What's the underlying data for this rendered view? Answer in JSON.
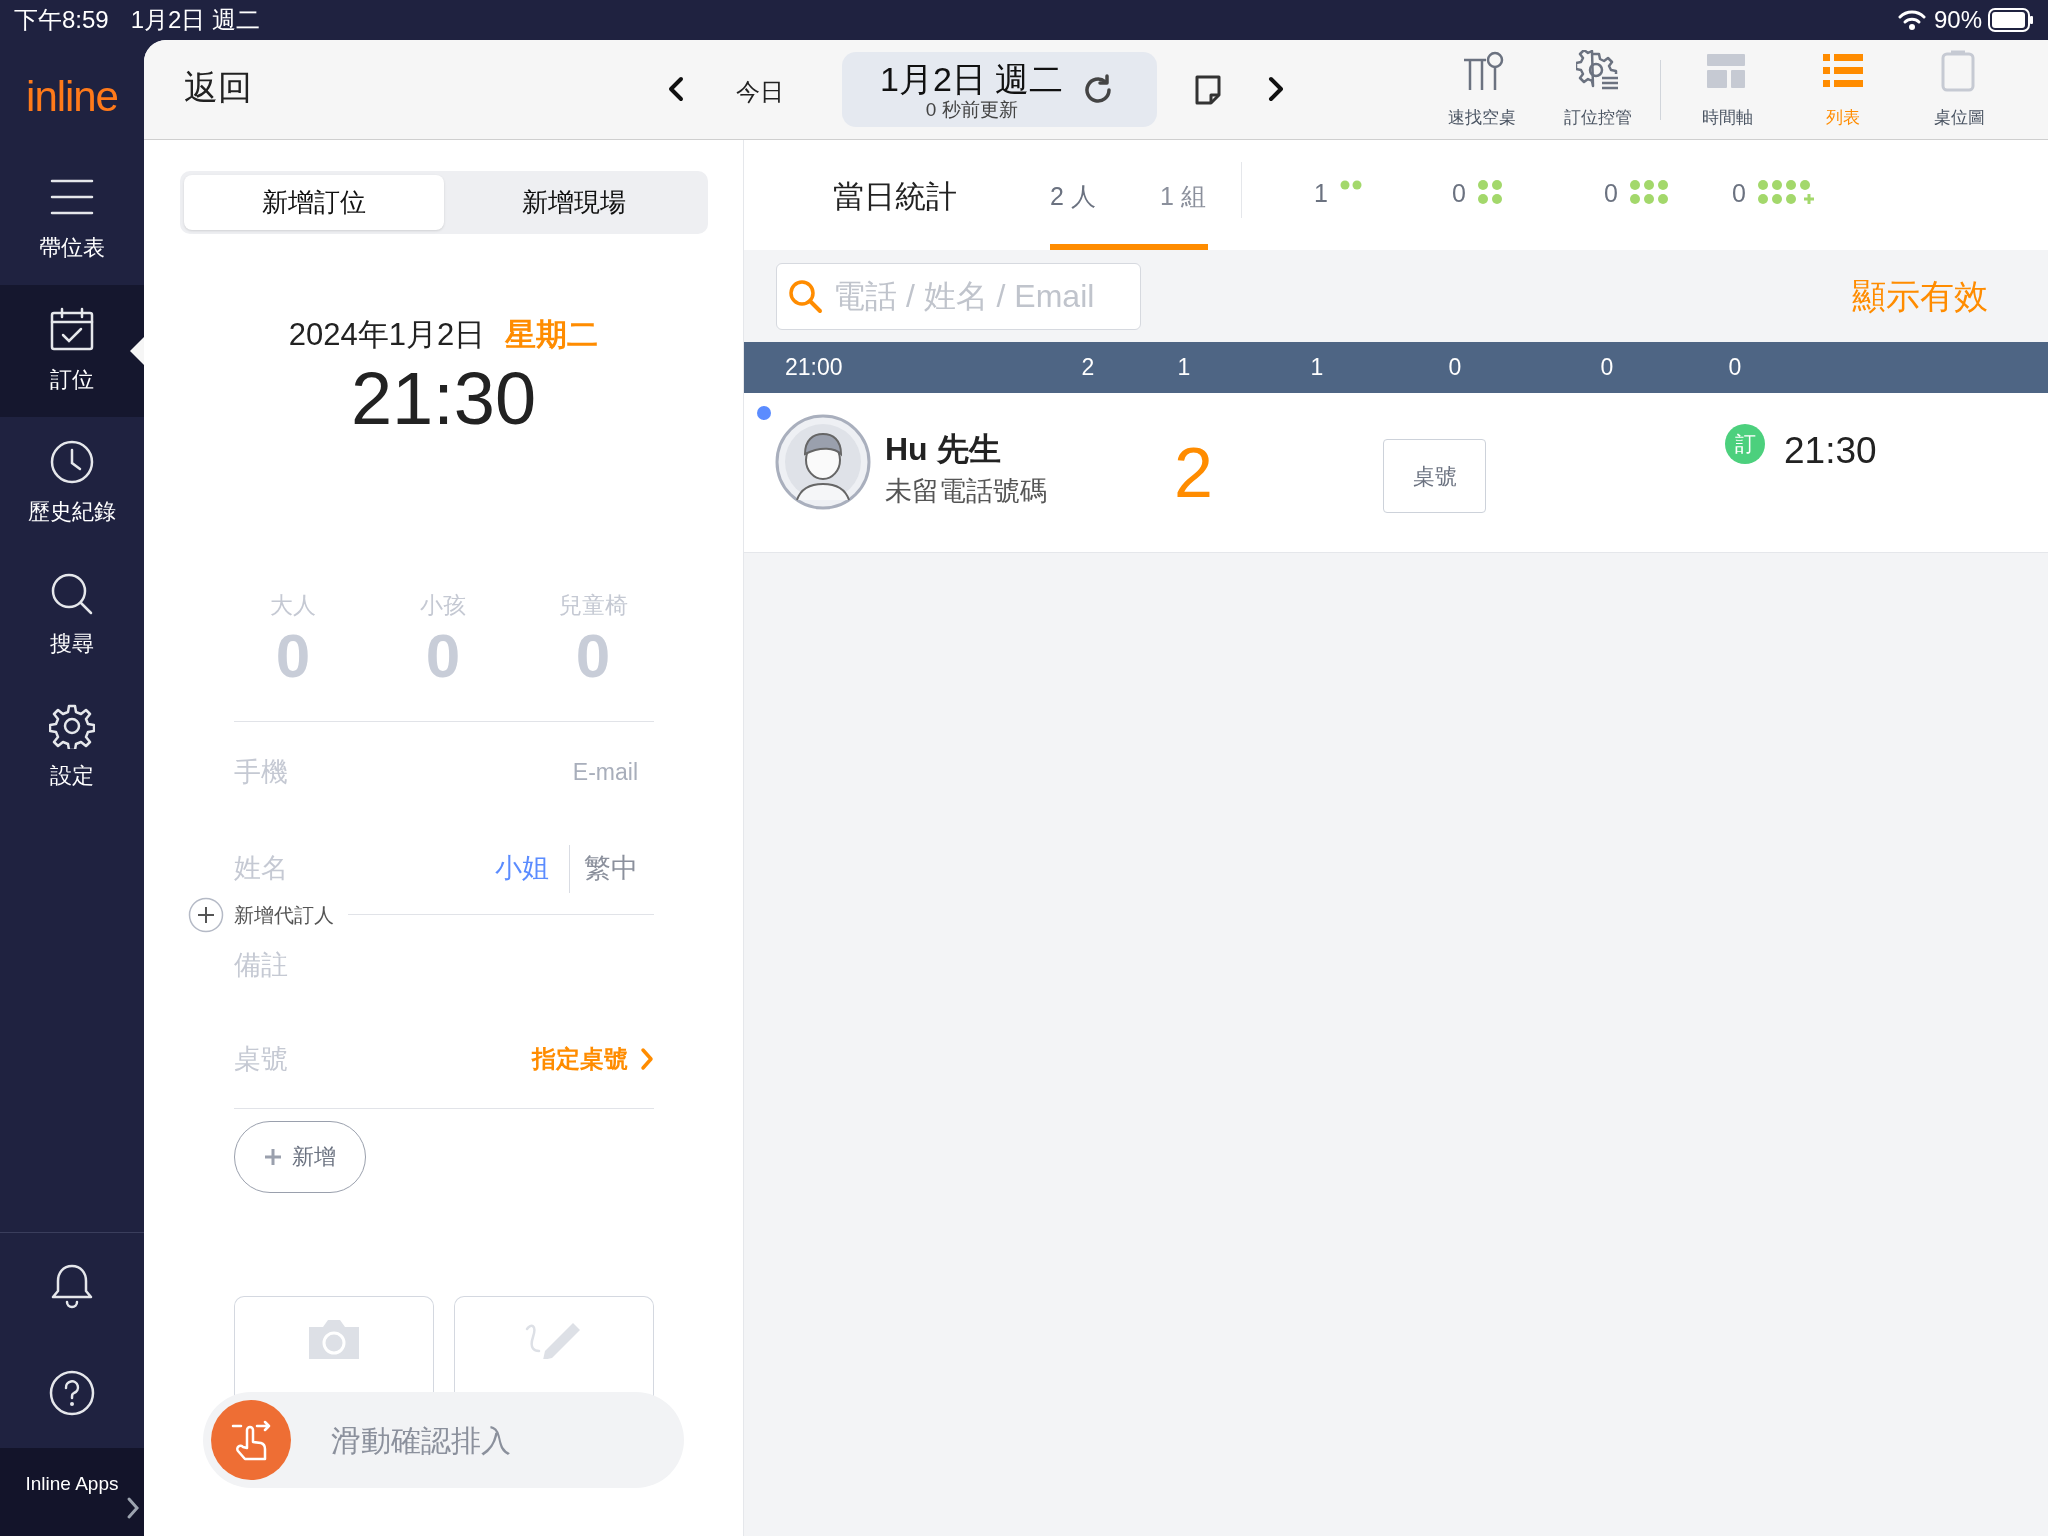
{
  "status_bar": {
    "time": "下午8:59",
    "date": "1月2日 週二",
    "battery": "90%"
  },
  "sidebar": {
    "logo": "inline",
    "items": [
      {
        "label": "帶位表",
        "selected": false
      },
      {
        "label": "訂位",
        "selected": true
      },
      {
        "label": "歷史紀錄",
        "selected": false
      },
      {
        "label": "搜尋",
        "selected": false
      },
      {
        "label": "設定",
        "selected": false
      }
    ],
    "apps_label": "Inline Apps"
  },
  "top_bar": {
    "back": "返回",
    "today": "今日",
    "date": "1月2日 週二",
    "updated": "0 秒前更新",
    "tools": [
      {
        "label": "速找空桌",
        "selected": false
      },
      {
        "label": "訂位控管",
        "selected": false
      },
      {
        "label": "時間軸",
        "selected": false
      },
      {
        "label": "列表",
        "selected": true
      },
      {
        "label": "桌位圖",
        "selected": false
      }
    ]
  },
  "form": {
    "tabs": [
      {
        "label": "新增訂位",
        "selected": true
      },
      {
        "label": "新增現場",
        "selected": false
      }
    ],
    "date": "2024年1月2日",
    "weekday": "星期二",
    "time": "21:30",
    "counters": [
      {
        "label": "大人",
        "value": "0"
      },
      {
        "label": "小孩",
        "value": "0"
      },
      {
        "label": "兒童椅",
        "value": "0"
      }
    ],
    "phone_placeholder": "手機",
    "email_placeholder": "E-mail",
    "name_placeholder": "姓名",
    "title": "小姐",
    "language": "繁中",
    "add_booker": "新增代訂人",
    "note_placeholder": "備註",
    "table_label": "桌號",
    "table_action": "指定桌號",
    "add_button": "新增",
    "slider": "滑動確認排入",
    "slider_level": {
      "level": 0
    }
  },
  "stats": {
    "title": "當日統計",
    "people": "2 人",
    "groups": "1 組",
    "party_sizes": [
      {
        "count": "1",
        "kind": "two"
      },
      {
        "count": "0",
        "kind": "four"
      },
      {
        "count": "0",
        "kind": "six"
      },
      {
        "count": "0",
        "kind": "more"
      }
    ]
  },
  "search": {
    "placeholder": "電話 / 姓名 / Email",
    "filter": "顯示有效"
  },
  "table": {
    "header": [
      "21:00",
      "2",
      "1",
      "1",
      "0",
      "0",
      "0"
    ],
    "rows": [
      {
        "name": "Hu 先生",
        "phone": "未留電話號碼",
        "party": "2",
        "table_button": "桌號",
        "badge": "訂",
        "time": "21:30",
        "unread": true
      }
    ]
  }
}
